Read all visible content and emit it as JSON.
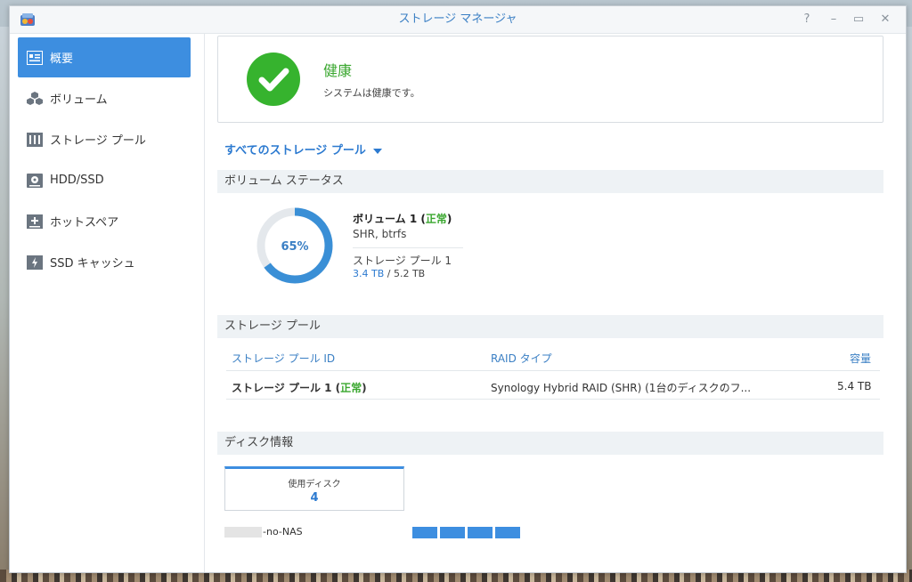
{
  "window": {
    "title": "ストレージ マネージャ",
    "controls": [
      "?",
      "–",
      "▭",
      "✕"
    ]
  },
  "sidebar": {
    "items": [
      {
        "label": "概要",
        "icon": "overview-icon",
        "active": true
      },
      {
        "label": "ボリューム",
        "icon": "volume-cubes-icon",
        "active": false
      },
      {
        "label": "ストレージ プール",
        "icon": "storage-pool-icon",
        "active": false
      },
      {
        "label": "HDD/SSD",
        "icon": "hdd-icon",
        "active": false
      },
      {
        "label": "ホットスペア",
        "icon": "hot-spare-icon",
        "active": false
      },
      {
        "label": "SSD キャッシュ",
        "icon": "ssd-cache-icon",
        "active": false
      }
    ]
  },
  "health": {
    "title": "健康",
    "subtitle": "システムは健康です。"
  },
  "pool_filter": {
    "label": "すべてのストレージ プール"
  },
  "volume_status": {
    "header": "ボリューム ステータス",
    "usage_percent": 65,
    "usage_label": "65%",
    "name": "ボリューム 1",
    "status_open": " (",
    "status": "正常",
    "status_close": ")",
    "fs": "SHR, btrfs",
    "pool": "ストレージ プール 1",
    "used": "3.4 TB",
    "separator": " / ",
    "total": "5.2 TB"
  },
  "storage_pool": {
    "header": "ストレージ プール",
    "columns": [
      "ストレージ プール ID",
      "RAID タイプ",
      "容量"
    ],
    "rows": [
      {
        "id": "ストレージ プール 1",
        "status": "正常",
        "raid": "Synology Hybrid RAID (SHR) (1台のディスクのフ...",
        "capacity": "5.4 TB"
      }
    ]
  },
  "disk_info": {
    "header": "ディスク情報",
    "used_label": "使用ディスク",
    "used_count": "4",
    "nas_name": "-no-NAS"
  },
  "colors": {
    "accent": "#3d8ee0",
    "ok_green": "#36b32e",
    "donut_track": "#e4e8ec"
  }
}
